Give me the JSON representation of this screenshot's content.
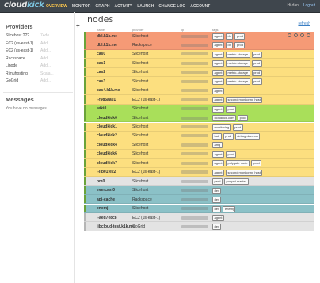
{
  "app": {
    "logo_main": "cloud",
    "logo_accent": "kick"
  },
  "nav": [
    {
      "label": "OVERVIEW",
      "active": true
    },
    {
      "label": "MONITOR",
      "active": false
    },
    {
      "label": "GRAPH",
      "active": false
    },
    {
      "label": "ACTIVITY",
      "active": false
    },
    {
      "label": "LAUNCH",
      "active": false
    },
    {
      "label": "CHANGE LOG",
      "active": false
    },
    {
      "label": "ACCOUNT",
      "active": false
    }
  ],
  "user": {
    "greeting": "Hi dan!",
    "logout": "Logout"
  },
  "providers": {
    "title": "Providers",
    "items": [
      {
        "name": "Slicehost ???",
        "meta": "74de..."
      },
      {
        "name": "EC2 (us-east-1)",
        "meta": "Add..."
      },
      {
        "name": "EC2 (us-east-1)",
        "meta": "Add..."
      },
      {
        "name": "Rackspace",
        "meta": "Add..."
      },
      {
        "name": "Linode",
        "meta": "Add..."
      },
      {
        "name": "Rimuhosting",
        "meta": "Scala..."
      },
      {
        "name": "GoGrid",
        "meta": "Add..."
      }
    ]
  },
  "messages": {
    "title": "Messages",
    "empty": "You have no messages..."
  },
  "main": {
    "title": "nodes",
    "add_icon": "+",
    "refresh": "refresh",
    "columns": [
      "name",
      "provider",
      "ip",
      "tags"
    ]
  },
  "colors": {
    "orange": "#f59a76",
    "yellow": "#fcdf7f",
    "green": "#a9df5a",
    "gray": "#e3e3e3",
    "teal": "#8bc1c7",
    "state_green": "#6aa33a",
    "state_gray": "#b6b6b6"
  },
  "rows": [
    {
      "name": "dbl.k1k.me",
      "provider": "Slicehost",
      "tags": [
        "agent",
        "db",
        "prod"
      ],
      "color": "orange",
      "state": "green",
      "actions": true
    },
    {
      "name": "dbl.k1k.me",
      "provider": "Rackspace",
      "tags": [
        "agent",
        "db",
        "prod"
      ],
      "color": "orange",
      "state": "green",
      "actions": false
    },
    {
      "name": "cas0",
      "provider": "Slicehost",
      "tags": [
        "agent",
        "metric-storage",
        "prod"
      ],
      "color": "yellow",
      "state": "green",
      "actions": false
    },
    {
      "name": "cas1",
      "provider": "Slicehost",
      "tags": [
        "agent",
        "metric-storage",
        "prod"
      ],
      "color": "yellow",
      "state": "green",
      "actions": false
    },
    {
      "name": "cas2",
      "provider": "Slicehost",
      "tags": [
        "agent",
        "metric-storage",
        "prod"
      ],
      "color": "yellow",
      "state": "green",
      "actions": false
    },
    {
      "name": "cas3",
      "provider": "Slicehost",
      "tags": [
        "agent",
        "metric-storage",
        "prod"
      ],
      "color": "yellow",
      "state": "green",
      "actions": false
    },
    {
      "name": "cas4.k1k.me",
      "provider": "Slicehost",
      "tags": [
        "agent"
      ],
      "color": "yellow",
      "state": "green",
      "actions": false
    },
    {
      "name": "i-f985aa01",
      "provider": "EC2 (us-east-1)",
      "tags": [
        "agent",
        "second monitoring host"
      ],
      "color": "yellow",
      "state": "green",
      "actions": false
    },
    {
      "name": "wiki0",
      "provider": "Slicehost",
      "tags": [
        "agent",
        "prod"
      ],
      "color": "green",
      "state": "green",
      "actions": false
    },
    {
      "name": "cloudkick0",
      "provider": "Slicehost",
      "tags": [
        "cloudkick.com",
        "prod"
      ],
      "color": "green",
      "state": "green",
      "actions": false
    },
    {
      "name": "cloudkick1",
      "provider": "Slicehost",
      "tags": [
        "monitoring",
        "prod"
      ],
      "color": "yellow",
      "state": "green",
      "actions": false
    },
    {
      "name": "cloudkick2",
      "provider": "Slicehost",
      "tags": [
        "hub",
        "prod",
        "debug daemon"
      ],
      "color": "yellow",
      "state": "green",
      "actions": false
    },
    {
      "name": "cloudkick4",
      "provider": "Slicehost",
      "tags": [
        "amq"
      ],
      "color": "yellow",
      "state": "green",
      "actions": false
    },
    {
      "name": "cloudkick6",
      "provider": "Slicehost",
      "tags": [
        "agent",
        "prod"
      ],
      "color": "yellow",
      "state": "green",
      "actions": false
    },
    {
      "name": "cloudkick7",
      "provider": "Slicehost",
      "tags": [
        "agent",
        "polygate node",
        "prod"
      ],
      "color": "yellow",
      "state": "green",
      "actions": false
    },
    {
      "name": "i-ilb01fe22",
      "provider": "EC2 (us-east-1)",
      "tags": [
        "agent",
        "second monitoring host"
      ],
      "color": "yellow",
      "state": "green",
      "actions": false
    },
    {
      "name": "pm0",
      "provider": "Slicehost",
      "tags": [
        "prod",
        "puppet master"
      ],
      "color": "gray",
      "state": "green",
      "actions": false
    },
    {
      "name": "evercast0",
      "provider": "Slicehost",
      "tags": [
        "dev"
      ],
      "color": "teal",
      "state": "green",
      "actions": false
    },
    {
      "name": "api-cache",
      "provider": "Rackspace",
      "tags": [
        "dev"
      ],
      "color": "teal",
      "state": "green",
      "actions": false
    },
    {
      "name": "enemj",
      "provider": "Slicehost",
      "tags": [
        "dev",
        "enemj"
      ],
      "color": "teal",
      "state": "green",
      "actions": false
    },
    {
      "name": "i-aed7e8c8",
      "provider": "EC2 (us-east-1)",
      "tags": [
        "agent"
      ],
      "color": "gray",
      "state": "gray",
      "actions": false
    },
    {
      "name": "libcloud-test.k1k.me",
      "provider": "GoGrid",
      "tags": [
        "dev"
      ],
      "color": "gray",
      "state": "gray",
      "actions": false
    }
  ]
}
